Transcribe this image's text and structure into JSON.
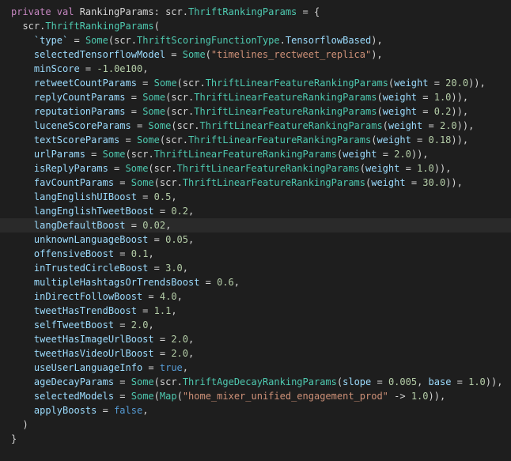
{
  "lines": [
    {
      "indent": 0,
      "tokens": [
        {
          "t": "private ",
          "c": "kw"
        },
        {
          "t": "val ",
          "c": "kw"
        },
        {
          "t": "RankingParams",
          "c": "ident"
        },
        {
          "t": ": ",
          "c": "punct"
        },
        {
          "t": "scr",
          "c": "ident"
        },
        {
          "t": ".",
          "c": "punct"
        },
        {
          "t": "ThriftRankingParams",
          "c": "type"
        },
        {
          "t": " = {",
          "c": "punct"
        }
      ]
    },
    {
      "indent": 1,
      "tokens": [
        {
          "t": "scr",
          "c": "ident"
        },
        {
          "t": ".",
          "c": "punct"
        },
        {
          "t": "ThriftRankingParams",
          "c": "type"
        },
        {
          "t": "(",
          "c": "punct"
        }
      ]
    },
    {
      "indent": 2,
      "tokens": [
        {
          "t": "`type`",
          "c": "member"
        },
        {
          "t": " = ",
          "c": "op"
        },
        {
          "t": "Some",
          "c": "type"
        },
        {
          "t": "(",
          "c": "punct"
        },
        {
          "t": "scr",
          "c": "ident"
        },
        {
          "t": ".",
          "c": "punct"
        },
        {
          "t": "ThriftScoringFunctionType",
          "c": "type"
        },
        {
          "t": ".",
          "c": "punct"
        },
        {
          "t": "TensorflowBased",
          "c": "member"
        },
        {
          "t": "),",
          "c": "punct"
        }
      ]
    },
    {
      "indent": 2,
      "tokens": [
        {
          "t": "selectedTensorflowModel",
          "c": "member"
        },
        {
          "t": " = ",
          "c": "op"
        },
        {
          "t": "Some",
          "c": "type"
        },
        {
          "t": "(",
          "c": "punct"
        },
        {
          "t": "\"timelines_rectweet_replica\"",
          "c": "str"
        },
        {
          "t": "),",
          "c": "punct"
        }
      ]
    },
    {
      "indent": 2,
      "tokens": [
        {
          "t": "minScore",
          "c": "member"
        },
        {
          "t": " = ",
          "c": "op"
        },
        {
          "t": "-1.0e100",
          "c": "num"
        },
        {
          "t": ",",
          "c": "punct"
        }
      ]
    },
    {
      "indent": 2,
      "tokens": [
        {
          "t": "retweetCountParams",
          "c": "member"
        },
        {
          "t": " = ",
          "c": "op"
        },
        {
          "t": "Some",
          "c": "type"
        },
        {
          "t": "(",
          "c": "punct"
        },
        {
          "t": "scr",
          "c": "ident"
        },
        {
          "t": ".",
          "c": "punct"
        },
        {
          "t": "ThriftLinearFeatureRankingParams",
          "c": "type"
        },
        {
          "t": "(",
          "c": "punct"
        },
        {
          "t": "weight",
          "c": "member"
        },
        {
          "t": " = ",
          "c": "op"
        },
        {
          "t": "20.0",
          "c": "num"
        },
        {
          "t": ")),",
          "c": "punct"
        }
      ]
    },
    {
      "indent": 2,
      "tokens": [
        {
          "t": "replyCountParams",
          "c": "member"
        },
        {
          "t": " = ",
          "c": "op"
        },
        {
          "t": "Some",
          "c": "type"
        },
        {
          "t": "(",
          "c": "punct"
        },
        {
          "t": "scr",
          "c": "ident"
        },
        {
          "t": ".",
          "c": "punct"
        },
        {
          "t": "ThriftLinearFeatureRankingParams",
          "c": "type"
        },
        {
          "t": "(",
          "c": "punct"
        },
        {
          "t": "weight",
          "c": "member"
        },
        {
          "t": " = ",
          "c": "op"
        },
        {
          "t": "1.0",
          "c": "num"
        },
        {
          "t": ")),",
          "c": "punct"
        }
      ]
    },
    {
      "indent": 2,
      "tokens": [
        {
          "t": "reputationParams",
          "c": "member"
        },
        {
          "t": " = ",
          "c": "op"
        },
        {
          "t": "Some",
          "c": "type"
        },
        {
          "t": "(",
          "c": "punct"
        },
        {
          "t": "scr",
          "c": "ident"
        },
        {
          "t": ".",
          "c": "punct"
        },
        {
          "t": "ThriftLinearFeatureRankingParams",
          "c": "type"
        },
        {
          "t": "(",
          "c": "punct"
        },
        {
          "t": "weight",
          "c": "member"
        },
        {
          "t": " = ",
          "c": "op"
        },
        {
          "t": "0.2",
          "c": "num"
        },
        {
          "t": ")),",
          "c": "punct"
        }
      ]
    },
    {
      "indent": 2,
      "tokens": [
        {
          "t": "luceneScoreParams",
          "c": "member"
        },
        {
          "t": " = ",
          "c": "op"
        },
        {
          "t": "Some",
          "c": "type"
        },
        {
          "t": "(",
          "c": "punct"
        },
        {
          "t": "scr",
          "c": "ident"
        },
        {
          "t": ".",
          "c": "punct"
        },
        {
          "t": "ThriftLinearFeatureRankingParams",
          "c": "type"
        },
        {
          "t": "(",
          "c": "punct"
        },
        {
          "t": "weight",
          "c": "member"
        },
        {
          "t": " = ",
          "c": "op"
        },
        {
          "t": "2.0",
          "c": "num"
        },
        {
          "t": ")),",
          "c": "punct"
        }
      ]
    },
    {
      "indent": 2,
      "tokens": [
        {
          "t": "textScoreParams",
          "c": "member"
        },
        {
          "t": " = ",
          "c": "op"
        },
        {
          "t": "Some",
          "c": "type"
        },
        {
          "t": "(",
          "c": "punct"
        },
        {
          "t": "scr",
          "c": "ident"
        },
        {
          "t": ".",
          "c": "punct"
        },
        {
          "t": "ThriftLinearFeatureRankingParams",
          "c": "type"
        },
        {
          "t": "(",
          "c": "punct"
        },
        {
          "t": "weight",
          "c": "member"
        },
        {
          "t": " = ",
          "c": "op"
        },
        {
          "t": "0.18",
          "c": "num"
        },
        {
          "t": ")),",
          "c": "punct"
        }
      ]
    },
    {
      "indent": 2,
      "tokens": [
        {
          "t": "urlParams",
          "c": "member"
        },
        {
          "t": " = ",
          "c": "op"
        },
        {
          "t": "Some",
          "c": "type"
        },
        {
          "t": "(",
          "c": "punct"
        },
        {
          "t": "scr",
          "c": "ident"
        },
        {
          "t": ".",
          "c": "punct"
        },
        {
          "t": "ThriftLinearFeatureRankingParams",
          "c": "type"
        },
        {
          "t": "(",
          "c": "punct"
        },
        {
          "t": "weight",
          "c": "member"
        },
        {
          "t": " = ",
          "c": "op"
        },
        {
          "t": "2.0",
          "c": "num"
        },
        {
          "t": ")),",
          "c": "punct"
        }
      ]
    },
    {
      "indent": 2,
      "tokens": [
        {
          "t": "isReplyParams",
          "c": "member"
        },
        {
          "t": " = ",
          "c": "op"
        },
        {
          "t": "Some",
          "c": "type"
        },
        {
          "t": "(",
          "c": "punct"
        },
        {
          "t": "scr",
          "c": "ident"
        },
        {
          "t": ".",
          "c": "punct"
        },
        {
          "t": "ThriftLinearFeatureRankingParams",
          "c": "type"
        },
        {
          "t": "(",
          "c": "punct"
        },
        {
          "t": "weight",
          "c": "member"
        },
        {
          "t": " = ",
          "c": "op"
        },
        {
          "t": "1.0",
          "c": "num"
        },
        {
          "t": ")),",
          "c": "punct"
        }
      ]
    },
    {
      "indent": 2,
      "tokens": [
        {
          "t": "favCountParams",
          "c": "member"
        },
        {
          "t": " = ",
          "c": "op"
        },
        {
          "t": "Some",
          "c": "type"
        },
        {
          "t": "(",
          "c": "punct"
        },
        {
          "t": "scr",
          "c": "ident"
        },
        {
          "t": ".",
          "c": "punct"
        },
        {
          "t": "ThriftLinearFeatureRankingParams",
          "c": "type"
        },
        {
          "t": "(",
          "c": "punct"
        },
        {
          "t": "weight",
          "c": "member"
        },
        {
          "t": " = ",
          "c": "op"
        },
        {
          "t": "30.0",
          "c": "num"
        },
        {
          "t": ")),",
          "c": "punct"
        }
      ]
    },
    {
      "indent": 2,
      "tokens": [
        {
          "t": "langEnglishUIBoost",
          "c": "member"
        },
        {
          "t": " = ",
          "c": "op"
        },
        {
          "t": "0.5",
          "c": "num"
        },
        {
          "t": ",",
          "c": "punct"
        }
      ]
    },
    {
      "indent": 2,
      "tokens": [
        {
          "t": "langEnglishTweetBoost",
          "c": "member"
        },
        {
          "t": " = ",
          "c": "op"
        },
        {
          "t": "0.2",
          "c": "num"
        },
        {
          "t": ",",
          "c": "punct"
        }
      ]
    },
    {
      "indent": 2,
      "highlighted": true,
      "tokens": [
        {
          "t": "langDefaultBoost",
          "c": "member"
        },
        {
          "t": " = ",
          "c": "op"
        },
        {
          "t": "0.02",
          "c": "num"
        },
        {
          "t": ",",
          "c": "punct"
        }
      ]
    },
    {
      "indent": 2,
      "tokens": [
        {
          "t": "unknownLanguageBoost",
          "c": "member"
        },
        {
          "t": " = ",
          "c": "op"
        },
        {
          "t": "0.05",
          "c": "num"
        },
        {
          "t": ",",
          "c": "punct"
        }
      ]
    },
    {
      "indent": 2,
      "tokens": [
        {
          "t": "offensiveBoost",
          "c": "member"
        },
        {
          "t": " = ",
          "c": "op"
        },
        {
          "t": "0.1",
          "c": "num"
        },
        {
          "t": ",",
          "c": "punct"
        }
      ]
    },
    {
      "indent": 2,
      "tokens": [
        {
          "t": "inTrustedCircleBoost",
          "c": "member"
        },
        {
          "t": " = ",
          "c": "op"
        },
        {
          "t": "3.0",
          "c": "num"
        },
        {
          "t": ",",
          "c": "punct"
        }
      ]
    },
    {
      "indent": 2,
      "tokens": [
        {
          "t": "multipleHashtagsOrTrendsBoost",
          "c": "member"
        },
        {
          "t": " = ",
          "c": "op"
        },
        {
          "t": "0.6",
          "c": "num"
        },
        {
          "t": ",",
          "c": "punct"
        }
      ]
    },
    {
      "indent": 2,
      "tokens": [
        {
          "t": "inDirectFollowBoost",
          "c": "member"
        },
        {
          "t": " = ",
          "c": "op"
        },
        {
          "t": "4.0",
          "c": "num"
        },
        {
          "t": ",",
          "c": "punct"
        }
      ]
    },
    {
      "indent": 2,
      "tokens": [
        {
          "t": "tweetHasTrendBoost",
          "c": "member"
        },
        {
          "t": " = ",
          "c": "op"
        },
        {
          "t": "1.1",
          "c": "num"
        },
        {
          "t": ",",
          "c": "punct"
        }
      ]
    },
    {
      "indent": 2,
      "tokens": [
        {
          "t": "selfTweetBoost",
          "c": "member"
        },
        {
          "t": " = ",
          "c": "op"
        },
        {
          "t": "2.0",
          "c": "num"
        },
        {
          "t": ",",
          "c": "punct"
        }
      ]
    },
    {
      "indent": 2,
      "tokens": [
        {
          "t": "tweetHasImageUrlBoost",
          "c": "member"
        },
        {
          "t": " = ",
          "c": "op"
        },
        {
          "t": "2.0",
          "c": "num"
        },
        {
          "t": ",",
          "c": "punct"
        }
      ]
    },
    {
      "indent": 2,
      "tokens": [
        {
          "t": "tweetHasVideoUrlBoost",
          "c": "member"
        },
        {
          "t": " = ",
          "c": "op"
        },
        {
          "t": "2.0",
          "c": "num"
        },
        {
          "t": ",",
          "c": "punct"
        }
      ]
    },
    {
      "indent": 2,
      "tokens": [
        {
          "t": "useUserLanguageInfo",
          "c": "member"
        },
        {
          "t": " = ",
          "c": "op"
        },
        {
          "t": "true",
          "c": "bool"
        },
        {
          "t": ",",
          "c": "punct"
        }
      ]
    },
    {
      "indent": 2,
      "tokens": [
        {
          "t": "ageDecayParams",
          "c": "member"
        },
        {
          "t": " = ",
          "c": "op"
        },
        {
          "t": "Some",
          "c": "type"
        },
        {
          "t": "(",
          "c": "punct"
        },
        {
          "t": "scr",
          "c": "ident"
        },
        {
          "t": ".",
          "c": "punct"
        },
        {
          "t": "ThriftAgeDecayRankingParams",
          "c": "type"
        },
        {
          "t": "(",
          "c": "punct"
        },
        {
          "t": "slope",
          "c": "member"
        },
        {
          "t": " = ",
          "c": "op"
        },
        {
          "t": "0.005",
          "c": "num"
        },
        {
          "t": ", ",
          "c": "punct"
        },
        {
          "t": "base",
          "c": "member"
        },
        {
          "t": " = ",
          "c": "op"
        },
        {
          "t": "1.0",
          "c": "num"
        },
        {
          "t": ")),",
          "c": "punct"
        }
      ]
    },
    {
      "indent": 2,
      "tokens": [
        {
          "t": "selectedModels",
          "c": "member"
        },
        {
          "t": " = ",
          "c": "op"
        },
        {
          "t": "Some",
          "c": "type"
        },
        {
          "t": "(",
          "c": "punct"
        },
        {
          "t": "Map",
          "c": "type"
        },
        {
          "t": "(",
          "c": "punct"
        },
        {
          "t": "\"home_mixer_unified_engagement_prod\"",
          "c": "str"
        },
        {
          "t": " -> ",
          "c": "op"
        },
        {
          "t": "1.0",
          "c": "num"
        },
        {
          "t": ")),",
          "c": "punct"
        }
      ]
    },
    {
      "indent": 2,
      "tokens": [
        {
          "t": "applyBoosts",
          "c": "member"
        },
        {
          "t": " = ",
          "c": "op"
        },
        {
          "t": "false",
          "c": "bool"
        },
        {
          "t": ",",
          "c": "punct"
        }
      ]
    },
    {
      "indent": 1,
      "tokens": [
        {
          "t": ")",
          "c": "punct"
        }
      ]
    },
    {
      "indent": 0,
      "tokens": [
        {
          "t": "}",
          "c": "punct"
        }
      ]
    }
  ]
}
